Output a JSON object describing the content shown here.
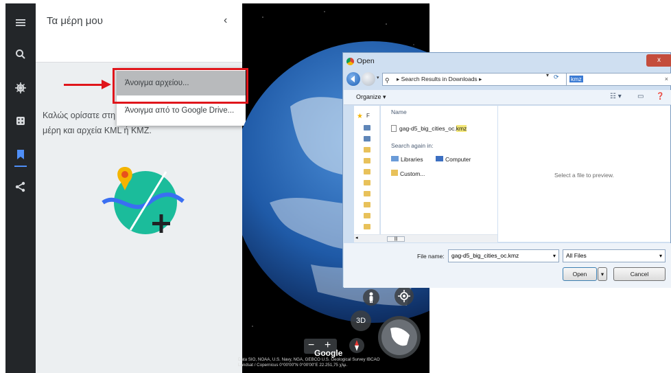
{
  "panel": {
    "title": "Τα μέρη μου",
    "collapse_icon": "‹",
    "welcome_text": "Καλώς ορίσατε στη ... μπορείτε να προσθέσετε μέρη και αρχεία KML ή KMZ."
  },
  "context_menu": {
    "items": [
      {
        "label": "Άνοιγμα αρχείου..."
      },
      {
        "label": "Άνοιγμα από το Google Drive..."
      }
    ]
  },
  "rail": {
    "icons": [
      "menu-icon",
      "search-icon",
      "voyager-icon",
      "feeling-lucky-icon",
      "projects-icon",
      "share-icon"
    ]
  },
  "globe": {
    "controls": {
      "toggle_3d": "3D",
      "zoom_out": "−",
      "zoom_in": "+"
    },
    "watermark": "Google",
    "attribution_line1": "Data SIO, NOAA, U.S. Navy, NGA, GEBCO  U.S. Geological Survey  IBCAO",
    "attribution_line2": "Landsat / Copernicus    0°00'00\"N 0°00'00\"E   22.251,75 χλμ."
  },
  "dialog": {
    "title": "Open",
    "close_label": "x",
    "address": "Search Results in Downloads",
    "address_arrow": "▸",
    "search_query": "kmz",
    "organize_label": "Organize",
    "column_name": "Name",
    "file_name_prefix": "gag-d5_big_cities_oc.",
    "file_name_suffix": "kmz",
    "search_again_label": "Search again in:",
    "locations": [
      "Libraries",
      "Computer",
      "Custom..."
    ],
    "preview_text": "Select a file to preview.",
    "filename_label": "File name:",
    "filename_value": "gag-d5_big_cities_oc.kmz",
    "filter_value": "All Files",
    "open_label": "Open",
    "cancel_label": "Cancel"
  },
  "colors": {
    "highlight_red": "#e0151b",
    "rail_bg": "#232629",
    "panel_bg": "#eceff1",
    "dialog_bg": "#cfdff1"
  }
}
